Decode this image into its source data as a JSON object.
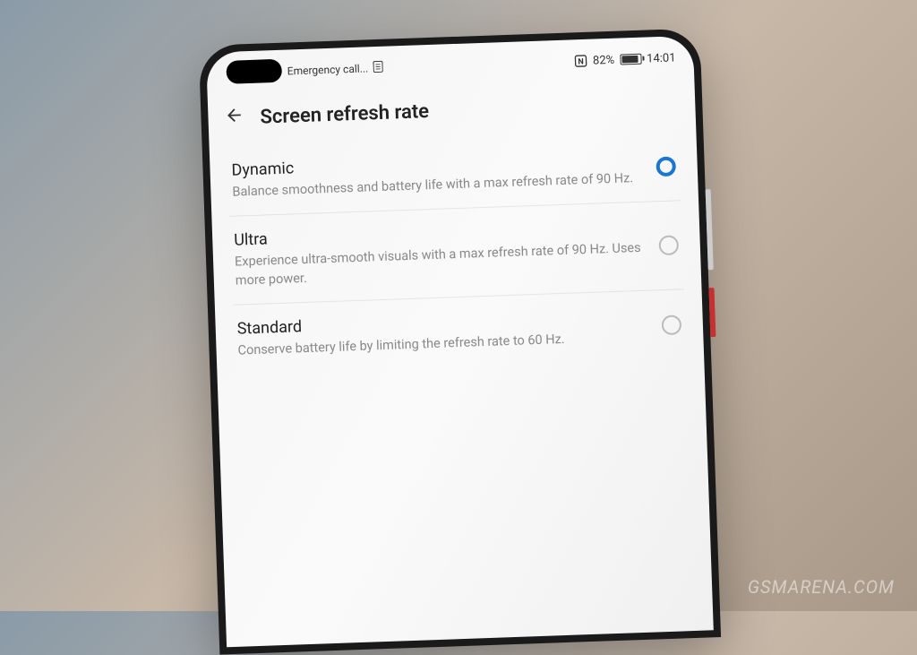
{
  "status_bar": {
    "carrier_text": "Emergency call...",
    "nfc_label": "N",
    "battery_percent": "82%",
    "time": "14:01"
  },
  "header": {
    "title": "Screen refresh rate"
  },
  "options": [
    {
      "title": "Dynamic",
      "description": "Balance smoothness and battery life with a max refresh rate of 90 Hz.",
      "selected": true
    },
    {
      "title": "Ultra",
      "description": "Experience ultra-smooth visuals with a max refresh rate of 90 Hz. Uses more power.",
      "selected": false
    },
    {
      "title": "Standard",
      "description": "Conserve battery life by limiting the refresh rate to 60 Hz.",
      "selected": false
    }
  ],
  "watermark": "GSMARENA.COM"
}
